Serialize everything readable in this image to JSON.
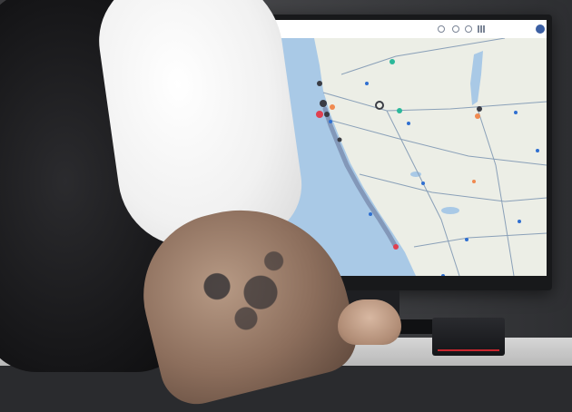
{
  "screen": {
    "header": {
      "user_label": ""
    },
    "map": {
      "colors": {
        "sea": "#a9c9e6",
        "land": "#eceee6",
        "road": "#8aa0b8",
        "route": "#7c8fb0",
        "marker_blue": "#2f6fd0",
        "marker_red": "#e04050",
        "marker_orange": "#f08a50",
        "marker_teal": "#2bb89a",
        "marker_dark": "#3a3c44"
      },
      "icons": [
        "pin-icon",
        "cluster-icon"
      ]
    }
  }
}
